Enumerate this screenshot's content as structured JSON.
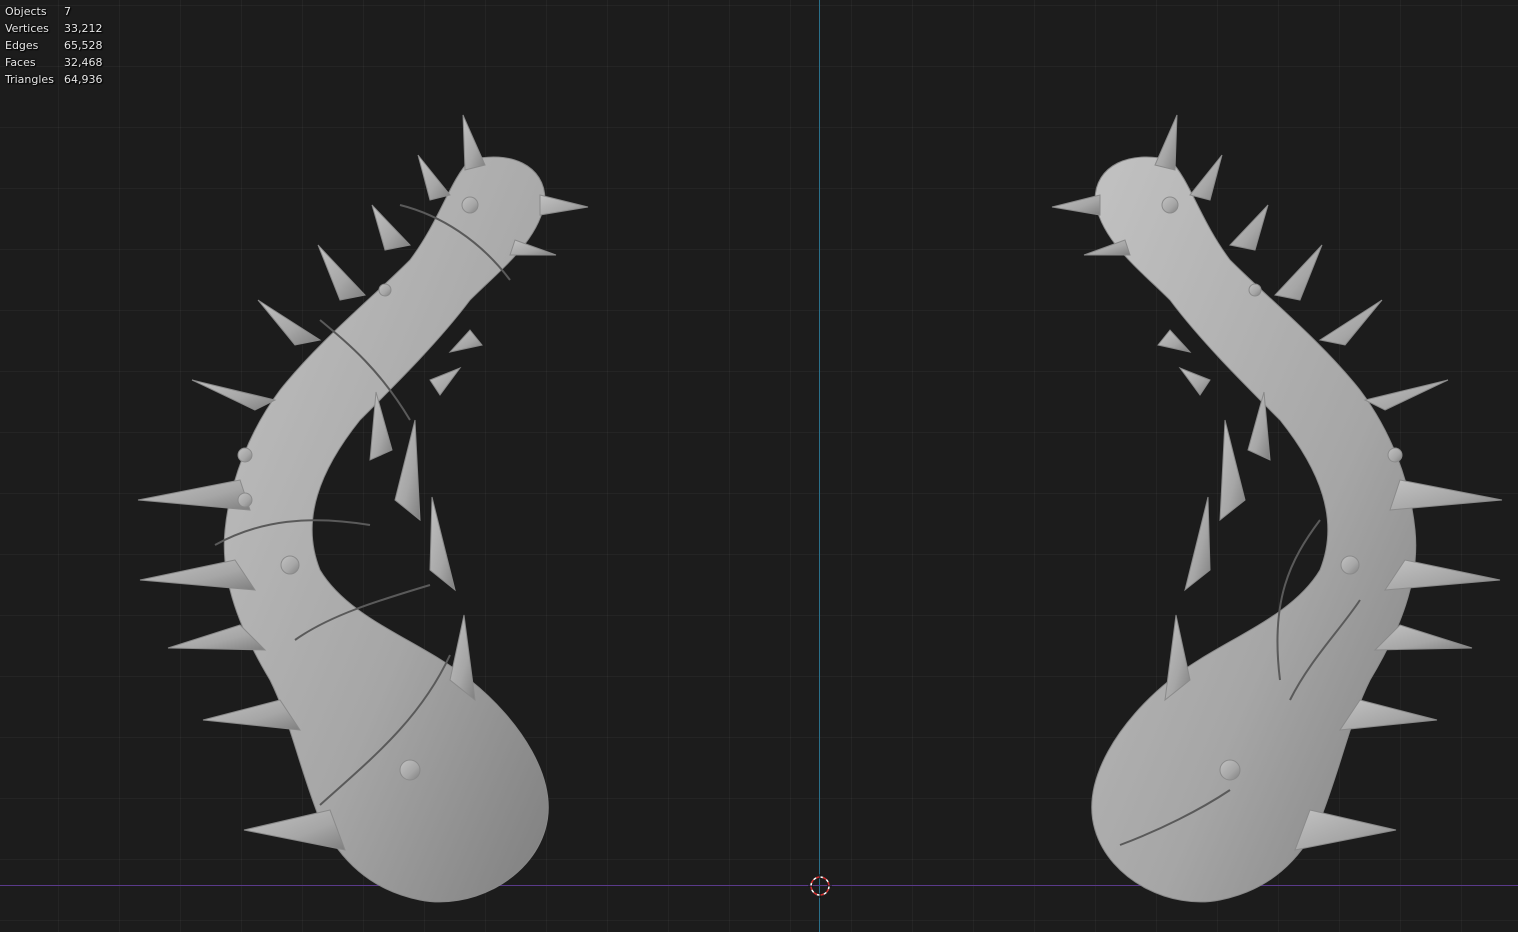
{
  "viewport": {
    "stats": [
      {
        "label": "Objects",
        "value": "7"
      },
      {
        "label": "Vertices",
        "value": "33,212"
      },
      {
        "label": "Edges",
        "value": "65,528"
      },
      {
        "label": "Faces",
        "value": "32,468"
      },
      {
        "label": "Triangles",
        "value": "64,936"
      }
    ],
    "colors": {
      "background": "#1c1c1c",
      "axis_z": "#2a6f8a",
      "axis_x": "#5a3a8a",
      "mesh": "#a9a9a9"
    },
    "icons": [
      "3d-cursor-icon"
    ]
  }
}
